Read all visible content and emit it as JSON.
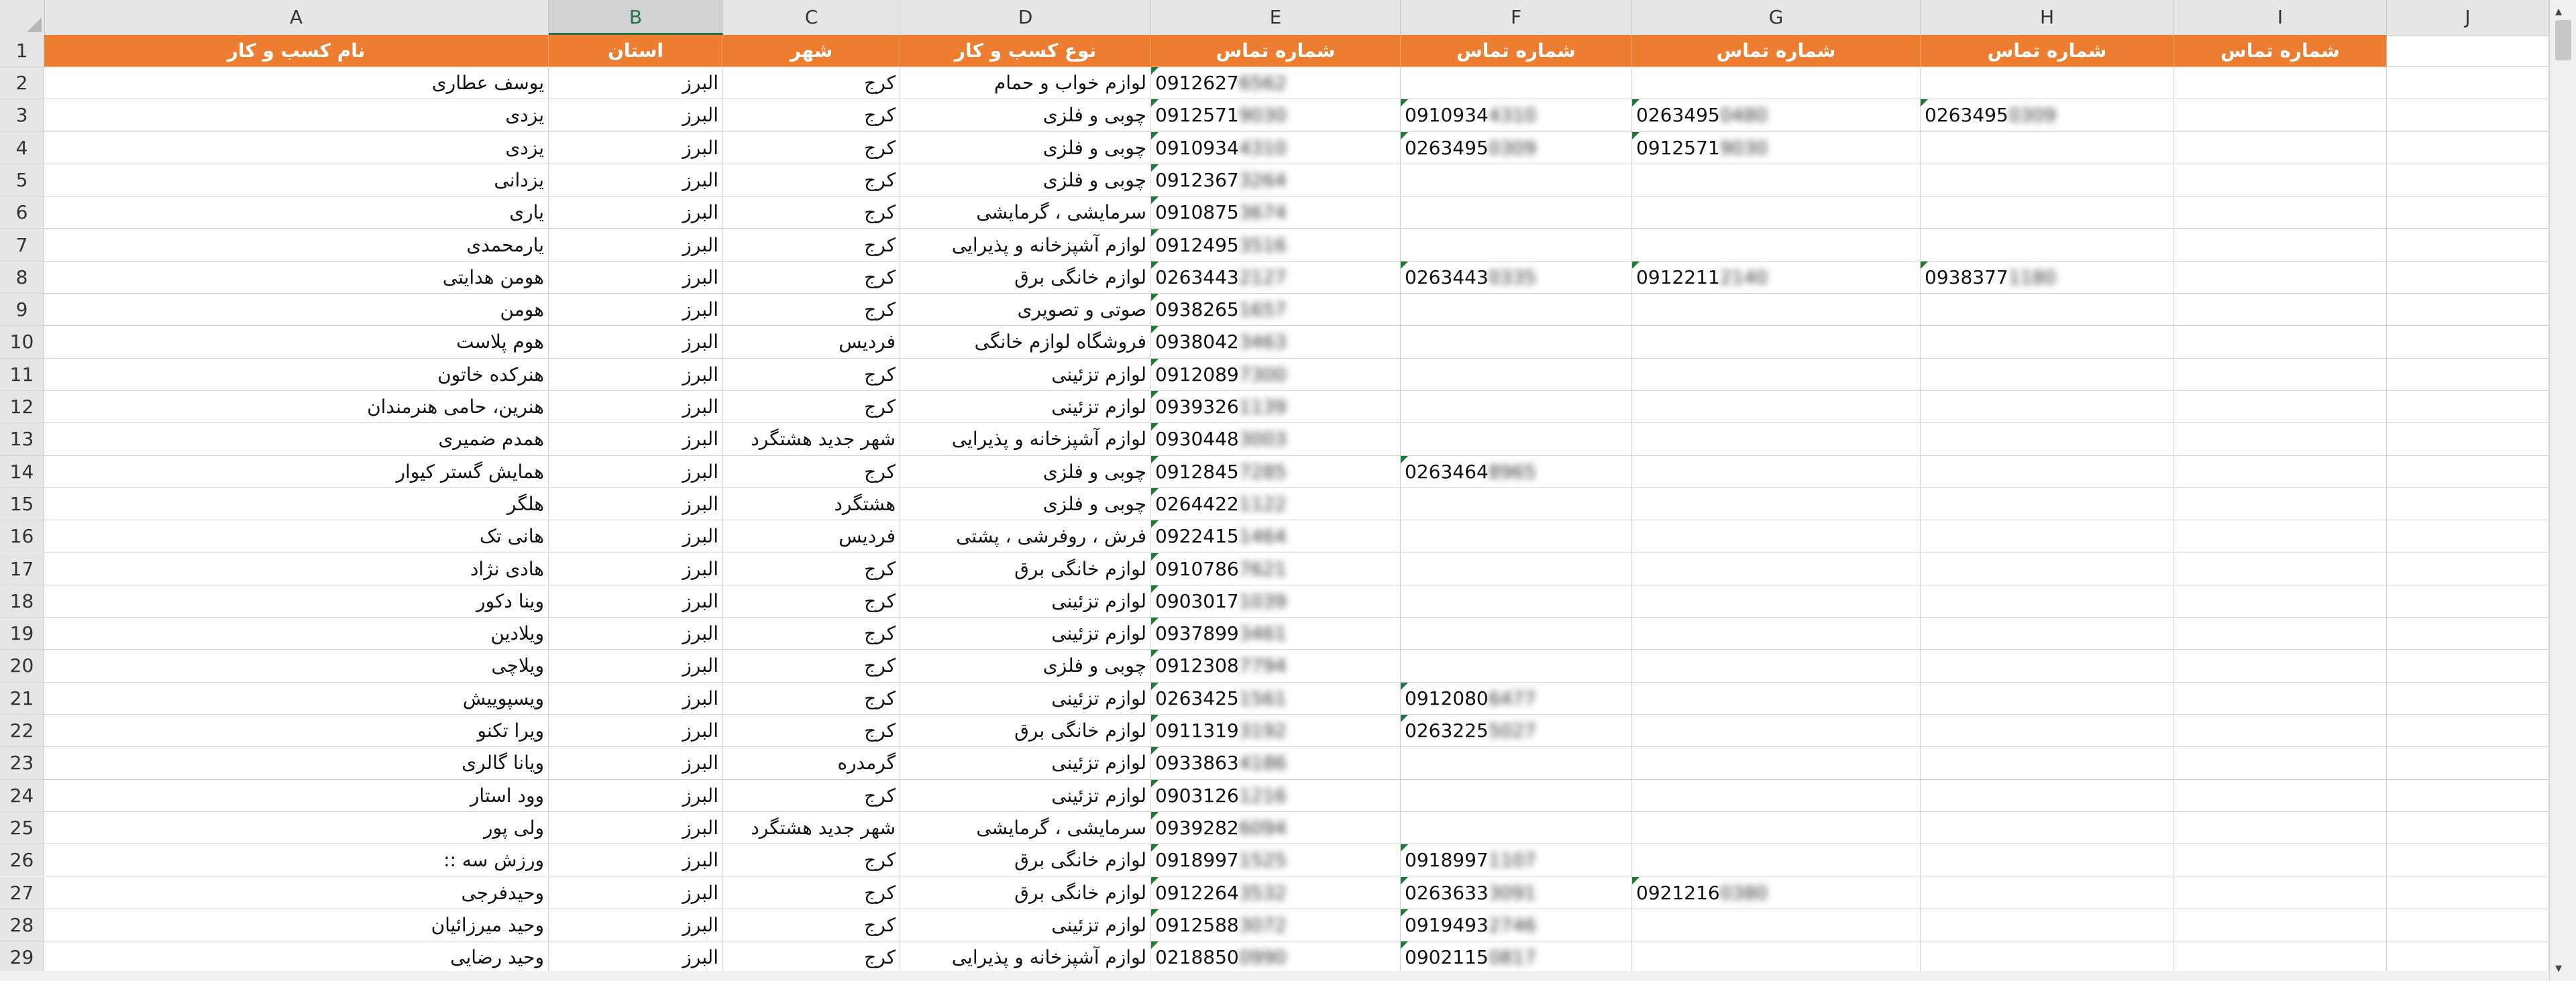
{
  "columns": [
    "A",
    "B",
    "C",
    "D",
    "E",
    "F",
    "G",
    "H",
    "I",
    "J"
  ],
  "selected_column": "B",
  "header_row": {
    "row_number": "1",
    "cells": [
      "نام کسب و کار",
      "استان",
      "شهر",
      "نوع کسب و کار",
      "شماره تماس",
      "شماره تماس",
      "شماره تماس",
      "شماره تماس",
      "شماره تماس"
    ]
  },
  "rows": [
    {
      "n": "2",
      "name": "یوسف عطاری",
      "province": "البرز",
      "city": "کرج",
      "type": "لوازم خواب و حمام",
      "phones": [
        {
          "v": "0912627",
          "m": "6562"
        }
      ]
    },
    {
      "n": "3",
      "name": "یزدی",
      "province": "البرز",
      "city": "کرج",
      "type": "چوبی و فلزی",
      "phones": [
        {
          "v": "0912571",
          "m": "9030"
        },
        {
          "v": "0910934",
          "m": "4310"
        },
        {
          "v": "0263495",
          "m": "0480"
        },
        {
          "v": "0263495",
          "m": "0309"
        }
      ]
    },
    {
      "n": "4",
      "name": "یزدی",
      "province": "البرز",
      "city": "کرج",
      "type": "چوبی و فلزی",
      "phones": [
        {
          "v": "0910934",
          "m": "4310"
        },
        {
          "v": "0263495",
          "m": "0309"
        },
        {
          "v": "0912571",
          "m": "9030"
        }
      ]
    },
    {
      "n": "5",
      "name": "یزدانی",
      "province": "البرز",
      "city": "کرج",
      "type": "چوبی و فلزی",
      "phones": [
        {
          "v": "0912367",
          "m": "3264"
        }
      ]
    },
    {
      "n": "6",
      "name": "یاری",
      "province": "البرز",
      "city": "کرج",
      "type": "سرمایشی ، گرمایشی",
      "phones": [
        {
          "v": "0910875",
          "m": "3674"
        }
      ]
    },
    {
      "n": "7",
      "name": "یارمحمدی",
      "province": "البرز",
      "city": "کرج",
      "type": "لوازم آشپزخانه و پذیرایی",
      "phones": [
        {
          "v": "0912495",
          "m": "3516"
        }
      ]
    },
    {
      "n": "8",
      "name": "هومن هدایتی",
      "province": "البرز",
      "city": "کرج",
      "type": "لوازم خانگی برق",
      "phones": [
        {
          "v": "0263443",
          "m": "2127"
        },
        {
          "v": "0263443",
          "m": "0335"
        },
        {
          "v": "0912211",
          "m": "2140"
        },
        {
          "v": "0938377",
          "m": "1180"
        }
      ]
    },
    {
      "n": "9",
      "name": "هومن",
      "province": "البرز",
      "city": "کرج",
      "type": "صوتی و تصویری",
      "phones": [
        {
          "v": "0938265",
          "m": "1657"
        }
      ]
    },
    {
      "n": "10",
      "name": "هوم پلاست",
      "province": "البرز",
      "city": "فردیس",
      "type": "فروشگاه لوازم خانگی",
      "phones": [
        {
          "v": "0938042",
          "m": "3463"
        }
      ]
    },
    {
      "n": "11",
      "name": "هنرکده خاتون",
      "province": "البرز",
      "city": "کرج",
      "type": "لوازم تزئینی",
      "phones": [
        {
          "v": "0912089",
          "m": "7300"
        }
      ]
    },
    {
      "n": "12",
      "name": "هنرین، حامی هنرمندان",
      "province": "البرز",
      "city": "کرج",
      "type": "لوازم تزئینی",
      "phones": [
        {
          "v": "0939326",
          "m": "1139"
        }
      ]
    },
    {
      "n": "13",
      "name": "همدم ضمیری",
      "province": "البرز",
      "city": "شهر جدید هشتگرد",
      "type": "لوازم آشپزخانه و پذیرایی",
      "phones": [
        {
          "v": "0930448",
          "m": "3003"
        }
      ]
    },
    {
      "n": "14",
      "name": "همایش گستر کیوار",
      "province": "البرز",
      "city": "کرج",
      "type": "چوبی و فلزی",
      "phones": [
        {
          "v": "0912845",
          "m": "7285"
        },
        {
          "v": "0263464",
          "m": "8965"
        }
      ]
    },
    {
      "n": "15",
      "name": "هلگر",
      "province": "البرز",
      "city": "هشتگرد",
      "type": "چوبی و فلزی",
      "phones": [
        {
          "v": "0264422",
          "m": "1122"
        }
      ]
    },
    {
      "n": "16",
      "name": "هانی تک",
      "province": "البرز",
      "city": "فردیس",
      "type": "فرش ، روفرشی ، پشتی",
      "phones": [
        {
          "v": "0922415",
          "m": "1464"
        }
      ]
    },
    {
      "n": "17",
      "name": "هادی نژاد",
      "province": "البرز",
      "city": "کرج",
      "type": "لوازم خانگی برق",
      "phones": [
        {
          "v": "0910786",
          "m": "7621"
        }
      ]
    },
    {
      "n": "18",
      "name": "وینا دکور",
      "province": "البرز",
      "city": "کرج",
      "type": "لوازم تزئینی",
      "phones": [
        {
          "v": "0903017",
          "m": "1039"
        }
      ]
    },
    {
      "n": "19",
      "name": "ویلادین",
      "province": "البرز",
      "city": "کرج",
      "type": "لوازم تزئینی",
      "phones": [
        {
          "v": "0937899",
          "m": "3461"
        }
      ]
    },
    {
      "n": "20",
      "name": "ویلاچی",
      "province": "البرز",
      "city": "کرج",
      "type": "چوبی و فلزی",
      "phones": [
        {
          "v": "0912308",
          "m": "7794"
        }
      ]
    },
    {
      "n": "21",
      "name": "ویسپوییش",
      "province": "البرز",
      "city": "کرج",
      "type": "لوازم تزئینی",
      "phones": [
        {
          "v": "0263425",
          "m": "1561"
        },
        {
          "v": "0912080",
          "m": "6477"
        }
      ]
    },
    {
      "n": "22",
      "name": "ویرا تکنو",
      "province": "البرز",
      "city": "کرج",
      "type": "لوازم خانگی برق",
      "phones": [
        {
          "v": "0911319",
          "m": "3192"
        },
        {
          "v": "0263225",
          "m": "5027"
        }
      ]
    },
    {
      "n": "23",
      "name": "ویانا گالری",
      "province": "البرز",
      "city": "گرمدره",
      "type": "لوازم تزئینی",
      "phones": [
        {
          "v": "0933863",
          "m": "4186"
        }
      ]
    },
    {
      "n": "24",
      "name": "وود استار",
      "province": "البرز",
      "city": "کرج",
      "type": "لوازم تزئینی",
      "phones": [
        {
          "v": "0903126",
          "m": "1216"
        }
      ]
    },
    {
      "n": "25",
      "name": "ولی پور",
      "province": "البرز",
      "city": "شهر جدید هشتگرد",
      "type": "سرمایشی ، گرمایشی",
      "phones": [
        {
          "v": "0939282",
          "m": "6094"
        }
      ]
    },
    {
      "n": "26",
      "name": "ورزش سه ::",
      "province": "البرز",
      "city": "کرج",
      "type": "لوازم خانگی برق",
      "phones": [
        {
          "v": "0918997",
          "m": "1525"
        },
        {
          "v": "0918997",
          "m": "1107"
        }
      ]
    },
    {
      "n": "27",
      "name": "وحیدفرجی",
      "province": "البرز",
      "city": "کرج",
      "type": "لوازم خانگی برق",
      "phones": [
        {
          "v": "0912264",
          "m": "3532"
        },
        {
          "v": "0263633",
          "m": "3091"
        },
        {
          "v": "0921216",
          "m": "0380"
        }
      ]
    },
    {
      "n": "28",
      "name": "وحید میرزائیان",
      "province": "البرز",
      "city": "کرج",
      "type": "لوازم تزئینی",
      "phones": [
        {
          "v": "0912588",
          "m": "3072"
        },
        {
          "v": "0919493",
          "m": "2746"
        }
      ]
    },
    {
      "n": "29",
      "name": "وحید رضایی",
      "province": "البرز",
      "city": "کرج",
      "type": "لوازم آشپزخانه و پذیرایی",
      "phones": [
        {
          "v": "0218850",
          "m": "0990"
        },
        {
          "v": "0902115",
          "m": "0817"
        }
      ]
    }
  ],
  "accent_colors": {
    "header_fill": "#ed7d31",
    "selected_col": "#217346",
    "comment_marker": "#1e7a34"
  }
}
